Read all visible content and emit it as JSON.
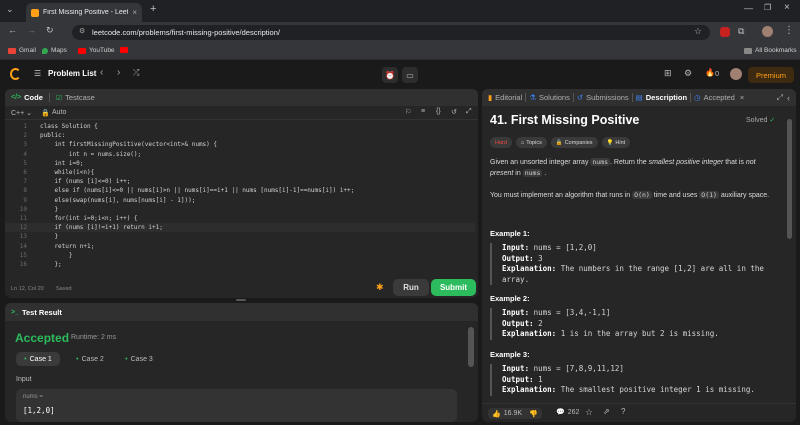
{
  "browser": {
    "tab_title": "First Missing Positive - LeetCod...",
    "url": "leetcode.com/problems/first-missing-positive/description/",
    "bookmarks": [
      "Gmail",
      "Maps",
      "YouTube"
    ],
    "all_bookmarks": "All Bookmarks"
  },
  "nav": {
    "problem_list": "Problem List",
    "premium": "Premium",
    "streak": "0"
  },
  "editor": {
    "tab_code": "Code",
    "tab_testcase": "Testcase",
    "language": "C++",
    "mode": "Auto",
    "status": "Ln 12, Col 20",
    "saved": "Saved",
    "run": "Run",
    "submit": "Submit",
    "lines": [
      "class Solution {",
      "public:",
      "    int firstMissingPositive(vector<int>& nums) {",
      "        int n = nums.size();",
      "    int i=0;",
      "    while(i<n){",
      "    if (nums [i]<=0) i++;",
      "    else if (nums[i]<=0 || nums[i]>n || nums[i]==i+1 || nums [nums[i]-1]==nums[i]) i++;",
      "    else(swap(nums[i], nums[nums[i] - 1]));",
      "    }",
      "    for(int i=0;i<n; i++) {",
      "    if (nums [i]!=i+1) return i+1;",
      "    }",
      "    return n+1;",
      "        }",
      "    };"
    ]
  },
  "result": {
    "title": "Test Result",
    "status": "Accepted",
    "runtime": "Runtime: 2 ms",
    "cases": [
      "Case 1",
      "Case 2",
      "Case 3"
    ],
    "input_label": "Input",
    "var_name": "nums =",
    "var_value": "[1,2,0]"
  },
  "desc": {
    "tabs": [
      "Editorial",
      "Solutions",
      "Submissions",
      "Description",
      "Accepted"
    ],
    "title": "41. First Missing Positive",
    "solved": "Solved",
    "tags": [
      "Hard",
      "Topics",
      "Companies",
      "Hint"
    ],
    "p1a": "Given an unsorted integer array ",
    "p1code": "nums",
    "p1b": ". Return the ",
    "p1em": "smallest positive integer",
    "p1c": " that is ",
    "p1em2": "not present",
    "p1d": " in ",
    "p1code2": "nums",
    "p1e": " .",
    "p2a": "You must implement an algorithm that runs in ",
    "p2code": "O(n)",
    "p2b": " time and uses ",
    "p2code2": "O(1)",
    "p2c": " auxiliary space.",
    "ex1_title": "Example 1:",
    "ex1_input": "nums = [1,2,0]",
    "ex1_output": "3",
    "ex1_expl": "The numbers in the range [1,2] are all in the",
    "ex1_expl2": "array.",
    "ex2_title": "Example 2:",
    "ex2_input": "nums = [3,4,-1,1]",
    "ex2_output": "2",
    "ex2_expl": "1 is in the array but 2 is missing.",
    "ex3_title": "Example 3:",
    "ex3_input": "nums = [7,8,9,11,12]",
    "ex3_output": "1",
    "ex3_expl": "The smallest positive integer 1 is missing.",
    "label_input": "Input:",
    "label_output": "Output:",
    "label_expl": "Explanation:",
    "likes": "16.9K",
    "comments": "262"
  },
  "colors": {
    "accent": "#ffa116",
    "success": "#2cbb5d",
    "hard": "#ef4743"
  }
}
